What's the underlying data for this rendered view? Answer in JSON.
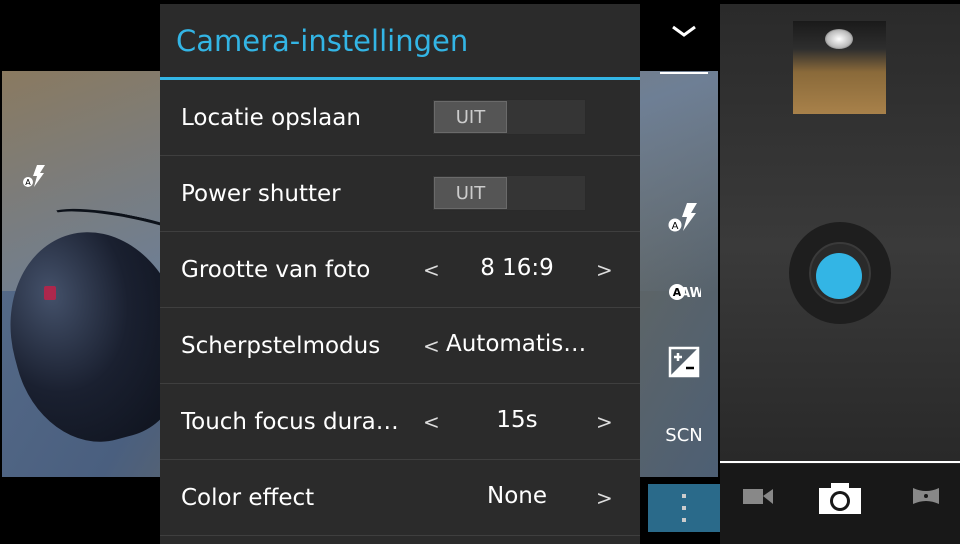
{
  "settings": {
    "title": "Camera-instellingen",
    "rows": [
      {
        "label": "Locatie opslaan",
        "toggle": "UIT"
      },
      {
        "label": "Power shutter",
        "toggle": "UIT"
      },
      {
        "label": "Grootte van foto",
        "value": "8 16:9",
        "left": "<",
        "right": ">"
      },
      {
        "label": "Scherpstelmodus",
        "value": "Automatis…",
        "left": "<"
      },
      {
        "label": "Touch focus dura…",
        "value": "15s",
        "left": "<",
        "right": ">"
      },
      {
        "label": "Color effect",
        "value": "None",
        "right": ">"
      }
    ]
  },
  "strip": {
    "collapse_icon": "chevron-down-icon",
    "flash_icon": "flash-auto-icon",
    "white_balance_icon": "white-balance-auto-icon",
    "white_balance_text": "AW",
    "exposure_icon": "exposure-icon",
    "scene_label": "SCN",
    "menu_icon": "overflow-menu-icon"
  },
  "controls": {
    "thumbnail_icon": "last-photo-thumbnail",
    "shutter_icon": "shutter-button",
    "modes": [
      "video-mode-icon",
      "photo-mode-icon",
      "panorama-mode-icon"
    ]
  },
  "colors": {
    "accent": "#33b5e5",
    "panel_bg": "#2b2b2b",
    "menu_bg": "#2a6a8a"
  }
}
